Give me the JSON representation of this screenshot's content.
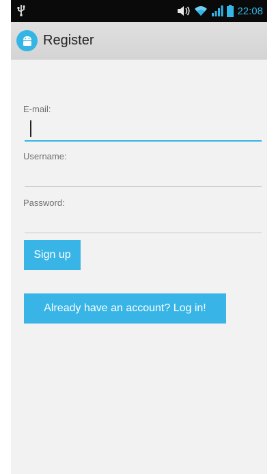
{
  "status_bar": {
    "time": "22:08",
    "icons": [
      "usb-icon",
      "volume-icon",
      "wifi-icon",
      "signal-icon",
      "battery-icon"
    ],
    "accent_color": "#33b5e5"
  },
  "action_bar": {
    "title": "Register",
    "icon": "android-app-icon"
  },
  "form": {
    "email_label": "E-mail:",
    "email_value": "",
    "username_label": "Username:",
    "username_value": "",
    "password_label": "Password:",
    "password_value": ""
  },
  "buttons": {
    "sign_up": "Sign up",
    "login": "Already have an account? Log in!"
  },
  "colors": {
    "accent": "#33b5e5",
    "background": "#f2f2f2"
  }
}
